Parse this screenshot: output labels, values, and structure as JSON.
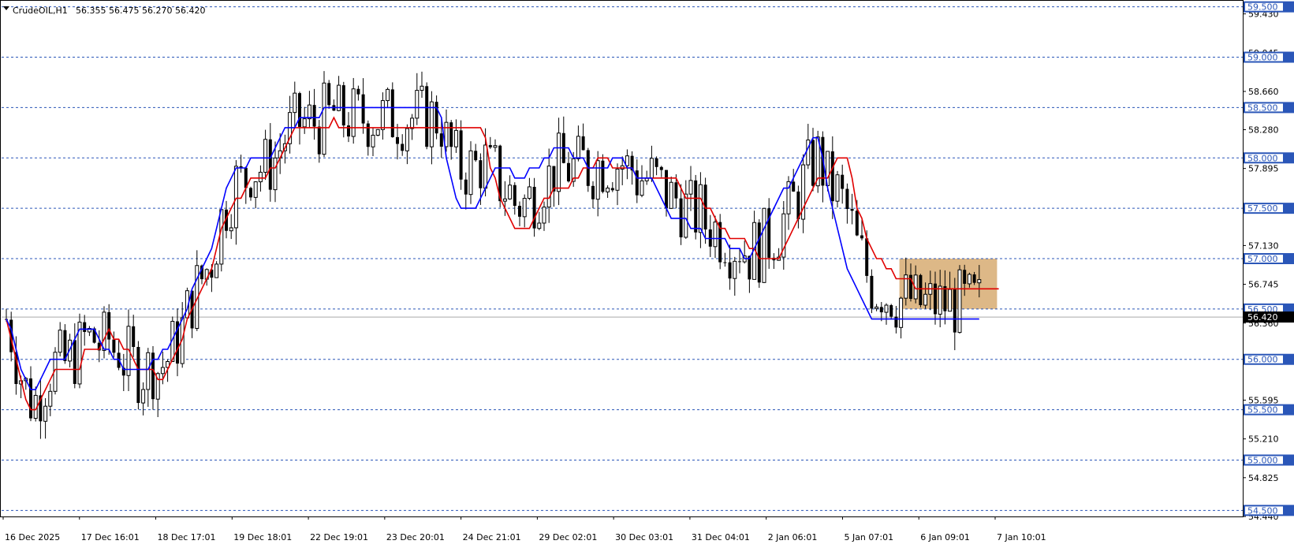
{
  "header": {
    "symbol": "CrudeOIL,H1",
    "ohlc": "56.355 56.475 56.270 56.420",
    "menu_icon": "triangle-down-icon"
  },
  "colors": {
    "background": "#ffffff",
    "grid_line": "#2a56b8",
    "level_label_bg": "#2a56b8",
    "bull_candle": "#000000",
    "bear_candle": "#000000",
    "ma_fast": "#e00000",
    "ma_slow": "#0000ff",
    "zone": "#ddb887",
    "current_price_bg": "#000000"
  },
  "chart_data": {
    "type": "candlestick",
    "ylim": [
      54.44,
      59.56
    ],
    "price_ticks": [
      "59.430",
      "59.045",
      "58.660",
      "58.280",
      "57.895",
      "57.130",
      "56.745",
      "56.360",
      "55.595",
      "55.210",
      "54.825",
      "54.440"
    ],
    "levels": [
      {
        "value": 59.5,
        "label": "59.500"
      },
      {
        "value": 59.0,
        "label": "59.000"
      },
      {
        "value": 58.5,
        "label": "58.500"
      },
      {
        "value": 58.0,
        "label": "58.000"
      },
      {
        "value": 57.5,
        "label": "57.500"
      },
      {
        "value": 57.0,
        "label": "57.000"
      },
      {
        "value": 56.5,
        "label": "56.500"
      },
      {
        "value": 56.0,
        "label": "56.000"
      },
      {
        "value": 55.5,
        "label": "55.500"
      },
      {
        "value": 55.0,
        "label": "55.000"
      },
      {
        "value": 54.5,
        "label": "54.500"
      }
    ],
    "current_price": {
      "value": 56.42,
      "label": "56.420"
    },
    "time_labels": [
      "16 Dec 2025",
      "17 Dec 16:01",
      "18 Dec 17:01",
      "19 Dec 18:01",
      "22 Dec 19:01",
      "23 Dec 20:01",
      "24 Dec 21:01",
      "29 Dec 02:01",
      "30 Dec 03:01",
      "31 Dec 04:01",
      "2 Jan 06:01",
      "5 Jan 07:01",
      "6 Jan 09:01",
      "7 Jan 10:01"
    ],
    "zone": {
      "price_top": 57.0,
      "price_bottom": 56.5,
      "start_index": 183,
      "end_index": 202
    },
    "series": [
      {
        "name": "ma_fast",
        "values": [
          56.4,
          56.2,
          56.0,
          55.8,
          55.6,
          55.5,
          55.5,
          55.6,
          55.7,
          55.8,
          55.9,
          55.9,
          55.9,
          55.9,
          55.9,
          55.9,
          56.1,
          56.1,
          56.1,
          56.1,
          56.2,
          56.3,
          56.2,
          56.2,
          56.1,
          56.1,
          56.0,
          55.9,
          55.9,
          55.9,
          55.9,
          55.8,
          55.8,
          55.9,
          56.0,
          56.1,
          56.2,
          56.4,
          56.5,
          56.6,
          56.7,
          56.8,
          56.9,
          57.1,
          57.3,
          57.4,
          57.5,
          57.6,
          57.6,
          57.7,
          57.8,
          57.8,
          57.8,
          57.8,
          57.9,
          57.9,
          58.0,
          58.1,
          58.2,
          58.3,
          58.3,
          58.3,
          58.3,
          58.3,
          58.3,
          58.3,
          58.3,
          58.4,
          58.3,
          58.3,
          58.3,
          58.3,
          58.3,
          58.3,
          58.3,
          58.3,
          58.3,
          58.3,
          58.3,
          58.3,
          58.3,
          58.3,
          58.3,
          58.3,
          58.3,
          58.3,
          58.3,
          58.3,
          58.3,
          58.3,
          58.3,
          58.3,
          58.3,
          58.3,
          58.3,
          58.3,
          58.3,
          58.3,
          58.2,
          57.9,
          57.8,
          57.6,
          57.5,
          57.4,
          57.3,
          57.3,
          57.3,
          57.3,
          57.4,
          57.5,
          57.6,
          57.6,
          57.7,
          57.7,
          57.7,
          57.7,
          57.8,
          57.8,
          57.9,
          57.9,
          57.9,
          58.0,
          58.0,
          58.0,
          57.9,
          57.9,
          57.9,
          57.9,
          57.9,
          57.8,
          57.8,
          57.8,
          57.8,
          57.8,
          57.8,
          57.8,
          57.8,
          57.8,
          57.7,
          57.6,
          57.6,
          57.6,
          57.6,
          57.5,
          57.5,
          57.4,
          57.3,
          57.3,
          57.2,
          57.2,
          57.2,
          57.2,
          57.1,
          57.1,
          57.0,
          57.0,
          57.0,
          57.0,
          57.0,
          57.1,
          57.2,
          57.3,
          57.4,
          57.5,
          57.6,
          57.7,
          57.8,
          57.8,
          57.8,
          57.9,
          58.0,
          58.0,
          58.0,
          57.8,
          57.5,
          57.4,
          57.2,
          57.1,
          57.0,
          57.0,
          56.9,
          56.9,
          56.8,
          56.8,
          56.8,
          56.8,
          56.7,
          56.7,
          56.7,
          56.7,
          56.7,
          56.7,
          56.7,
          56.7,
          56.7,
          56.7,
          56.7,
          56.7,
          56.7,
          56.7,
          56.7,
          56.7,
          56.7,
          56.7
        ]
      },
      {
        "name": "ma_slow",
        "values": [
          56.4,
          56.3,
          56.1,
          55.9,
          55.8,
          55.7,
          55.7,
          55.8,
          55.9,
          56.0,
          56.0,
          56.0,
          56.0,
          56.1,
          56.2,
          56.3,
          56.3,
          56.3,
          56.3,
          56.2,
          56.1,
          56.1,
          56.0,
          56.0,
          55.9,
          55.9,
          55.9,
          55.9,
          55.9,
          55.9,
          56.0,
          56.0,
          56.1,
          56.1,
          56.2,
          56.3,
          56.4,
          56.5,
          56.7,
          56.8,
          56.9,
          57.0,
          57.1,
          57.3,
          57.5,
          57.7,
          57.8,
          57.9,
          57.9,
          57.9,
          58.0,
          58.0,
          58.0,
          58.0,
          58.0,
          58.1,
          58.2,
          58.3,
          58.3,
          58.3,
          58.4,
          58.4,
          58.4,
          58.4,
          58.4,
          58.5,
          58.5,
          58.5,
          58.5,
          58.5,
          58.5,
          58.5,
          58.5,
          58.5,
          58.5,
          58.5,
          58.5,
          58.5,
          58.5,
          58.5,
          58.5,
          58.5,
          58.5,
          58.5,
          58.5,
          58.5,
          58.5,
          58.5,
          58.5,
          58.4,
          58.0,
          57.8,
          57.6,
          57.5,
          57.5,
          57.5,
          57.5,
          57.6,
          57.7,
          57.8,
          57.9,
          57.9,
          57.9,
          57.9,
          57.8,
          57.8,
          57.8,
          57.9,
          57.9,
          57.9,
          58.0,
          58.0,
          58.1,
          58.1,
          58.1,
          58.1,
          58.0,
          58.0,
          58.0,
          57.9,
          57.9,
          57.9,
          57.9,
          57.9,
          58.0,
          58.0,
          58.0,
          57.9,
          57.9,
          57.8,
          57.8,
          57.8,
          57.8,
          57.7,
          57.6,
          57.5,
          57.4,
          57.4,
          57.4,
          57.4,
          57.3,
          57.3,
          57.3,
          57.2,
          57.2,
          57.2,
          57.2,
          57.2,
          57.1,
          57.1,
          57.1,
          57.0,
          57.0,
          57.1,
          57.2,
          57.3,
          57.4,
          57.5,
          57.6,
          57.7,
          57.7,
          57.8,
          57.9,
          58.0,
          58.1,
          58.2,
          58.2,
          58.0,
          57.7,
          57.5,
          57.3,
          57.1,
          56.9,
          56.8,
          56.7,
          56.6,
          56.5,
          56.4,
          56.4,
          56.4,
          56.4,
          56.4,
          56.4,
          56.4,
          56.4,
          56.4,
          56.4,
          56.4,
          56.4,
          56.4,
          56.4,
          56.4,
          56.4,
          56.4,
          56.4,
          56.4,
          56.4,
          56.4,
          56.4,
          56.4
        ]
      }
    ]
  }
}
